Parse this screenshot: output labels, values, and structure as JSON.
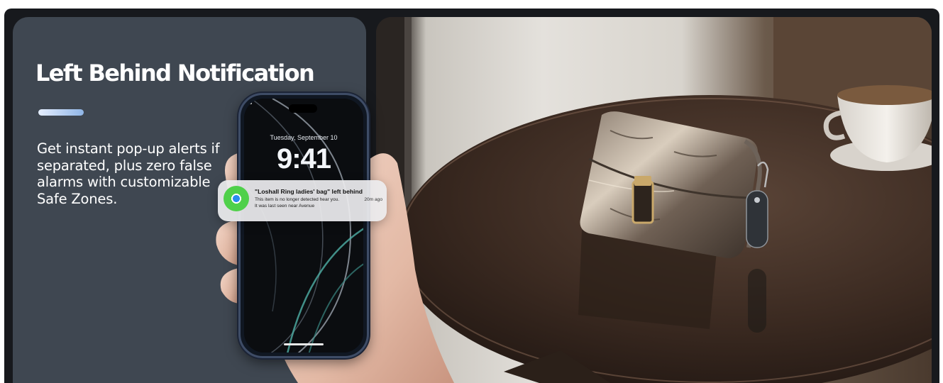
{
  "panel": {
    "headline": "Left Behind Notification",
    "description": "Get instant pop-up alerts if separated, plus zero false alarms with customizable Safe Zones."
  },
  "phone": {
    "date": "Tuesday, September 10",
    "time": "9:41",
    "notification": {
      "title": "\"Loshall Ring ladies' bag\" left behind",
      "body_line1": "This item is no longer detected hear you.",
      "body_line2": "It was last seen near Avenue",
      "time_ago": "20m ago"
    }
  },
  "colors": {
    "panel_bg": "#3f4751",
    "frame_bg": "#17191d",
    "accent_bar": "#a9c7ee",
    "phone_frame": "#3e4c66"
  },
  "icons": {
    "notification": "find-my-icon",
    "camera": "camera-icon"
  }
}
